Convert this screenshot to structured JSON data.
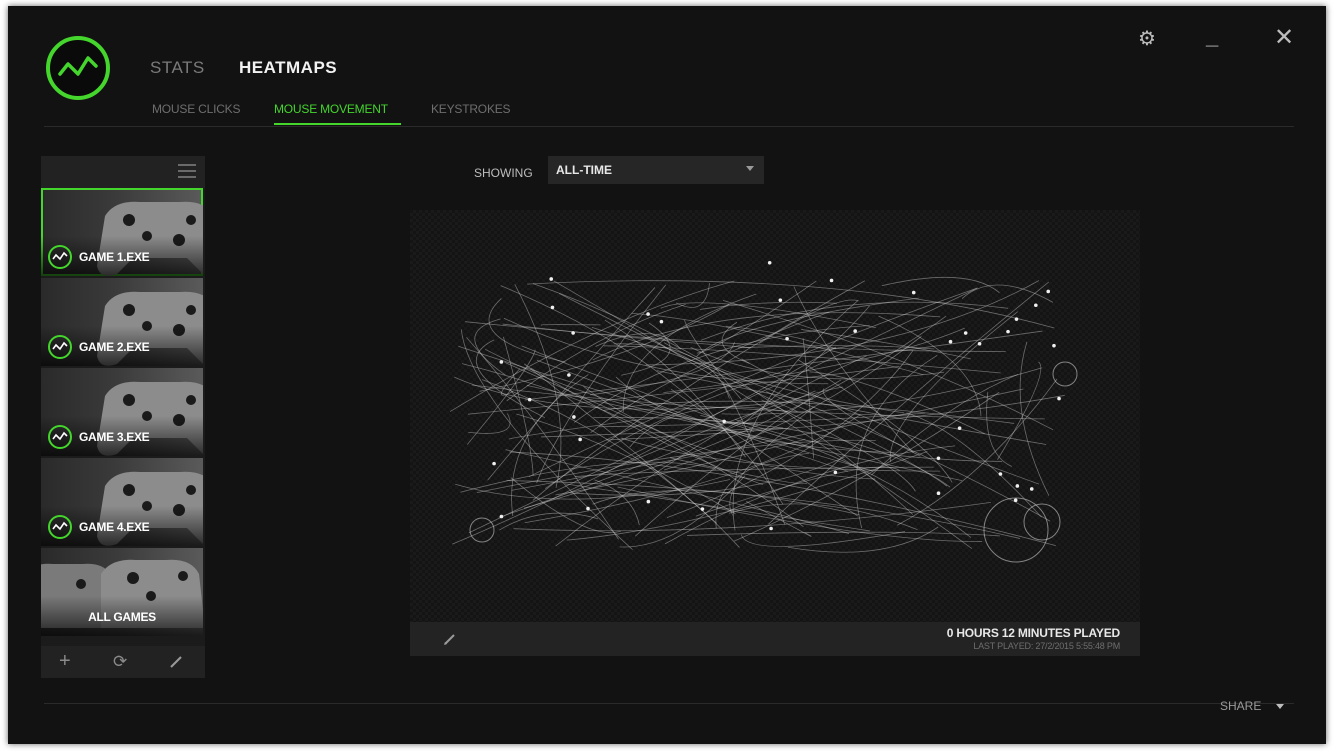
{
  "header": {
    "nav": {
      "stats": "STATS",
      "heatmaps": "HEATMAPS"
    },
    "subtabs": {
      "mouse_clicks": "MOUSE CLICKS",
      "mouse_movement": "MOUSE MOVEMENT",
      "keystrokes": "KEYSTROKES"
    },
    "active_subtab": "MOUSE MOVEMENT",
    "window_controls": [
      "gear-icon",
      "minimize-icon",
      "close-icon"
    ]
  },
  "sidebar": {
    "games": [
      {
        "label": "GAME 1.EXE",
        "selected": true
      },
      {
        "label": "GAME 2.EXE",
        "selected": false
      },
      {
        "label": "GAME 3.EXE",
        "selected": false
      },
      {
        "label": "GAME 4.EXE",
        "selected": false
      }
    ],
    "all_games": "ALL GAMES",
    "footer_icons": [
      "plus-icon",
      "refresh-icon",
      "edit-icon"
    ]
  },
  "filter": {
    "label": "SHOWING",
    "value": "ALL-TIME"
  },
  "heatmap": {
    "play_time": "0 HOURS 12 MINUTES PLAYED",
    "last_played": "LAST PLAYED: 27/2/2015 5:55:48 PM"
  },
  "share": {
    "label": "SHARE"
  },
  "colors": {
    "accent": "#44d62c",
    "background": "#121212",
    "panel": "#232323"
  }
}
